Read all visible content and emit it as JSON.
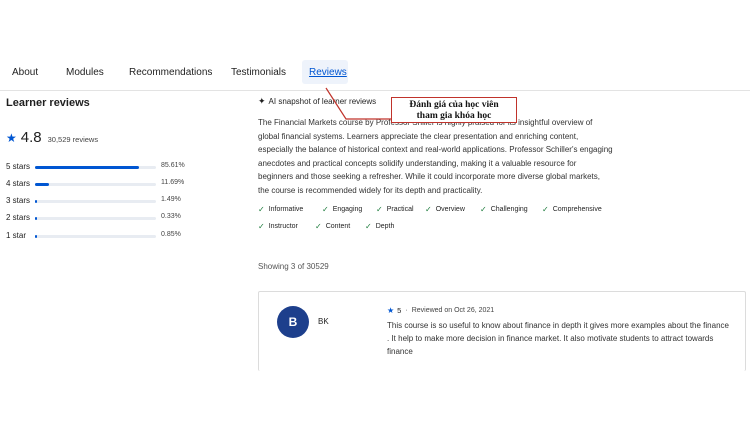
{
  "tabs": [
    {
      "label": "About"
    },
    {
      "label": "Modules"
    },
    {
      "label": "Recommendations"
    },
    {
      "label": "Testimonials"
    },
    {
      "label": "Reviews",
      "active": true
    }
  ],
  "learner_reviews": {
    "title": "Learner reviews",
    "rating": "4.8",
    "count_text": "30,529 reviews",
    "breakdown": [
      {
        "label": "5 stars",
        "pct_text": "85.61%",
        "fraction": 0.8561
      },
      {
        "label": "4 stars",
        "pct_text": "11.69%",
        "fraction": 0.1169
      },
      {
        "label": "3 stars",
        "pct_text": "1.49%",
        "fraction": 0.0149
      },
      {
        "label": "2 stars",
        "pct_text": "0.33%",
        "fraction": 0.0033
      },
      {
        "label": "1 star",
        "pct_text": "0.85%",
        "fraction": 0.0085
      }
    ]
  },
  "ai_snapshot": {
    "heading": "AI snapshot of learner reviews",
    "summary": "The Financial Markets course by Professor Shiller is highly praised for its insightful overview of global financial systems. Learners appreciate the clear presentation and enriching content, especially the balance of historical context and real-world applications. Professor Schiller's engaging anecdotes and practical concepts solidify understanding, making it a valuable resource for beginners and those seeking a refresher. While it could incorporate more diverse global markets, the course is recommended widely for its depth and practicality.",
    "tags_row1": [
      "Informative",
      "Engaging",
      "Practical",
      "Overview",
      "Challenging",
      "Comprehensive"
    ],
    "tags_row2": [
      "Instructor",
      "Content",
      "Depth"
    ]
  },
  "showing_text": "Showing 3 of 30529",
  "review": {
    "avatar_initial": "B",
    "reviewer": "BK",
    "rating": "5",
    "date_text": "Reviewed on Oct 26, 2021",
    "text": "This course is so useful to know about finance in depth it gives more examples about the finance . It help to make more decision in finance market. It also motivate students to attract towards finance"
  },
  "annotation": {
    "line1": "Đánh giá của học viên",
    "line2": "tham gia khóa học",
    "color": "#c0332b"
  },
  "colors": {
    "accent": "#0056d2",
    "avatar": "#1d3f8c",
    "check": "#1a7a3a"
  }
}
